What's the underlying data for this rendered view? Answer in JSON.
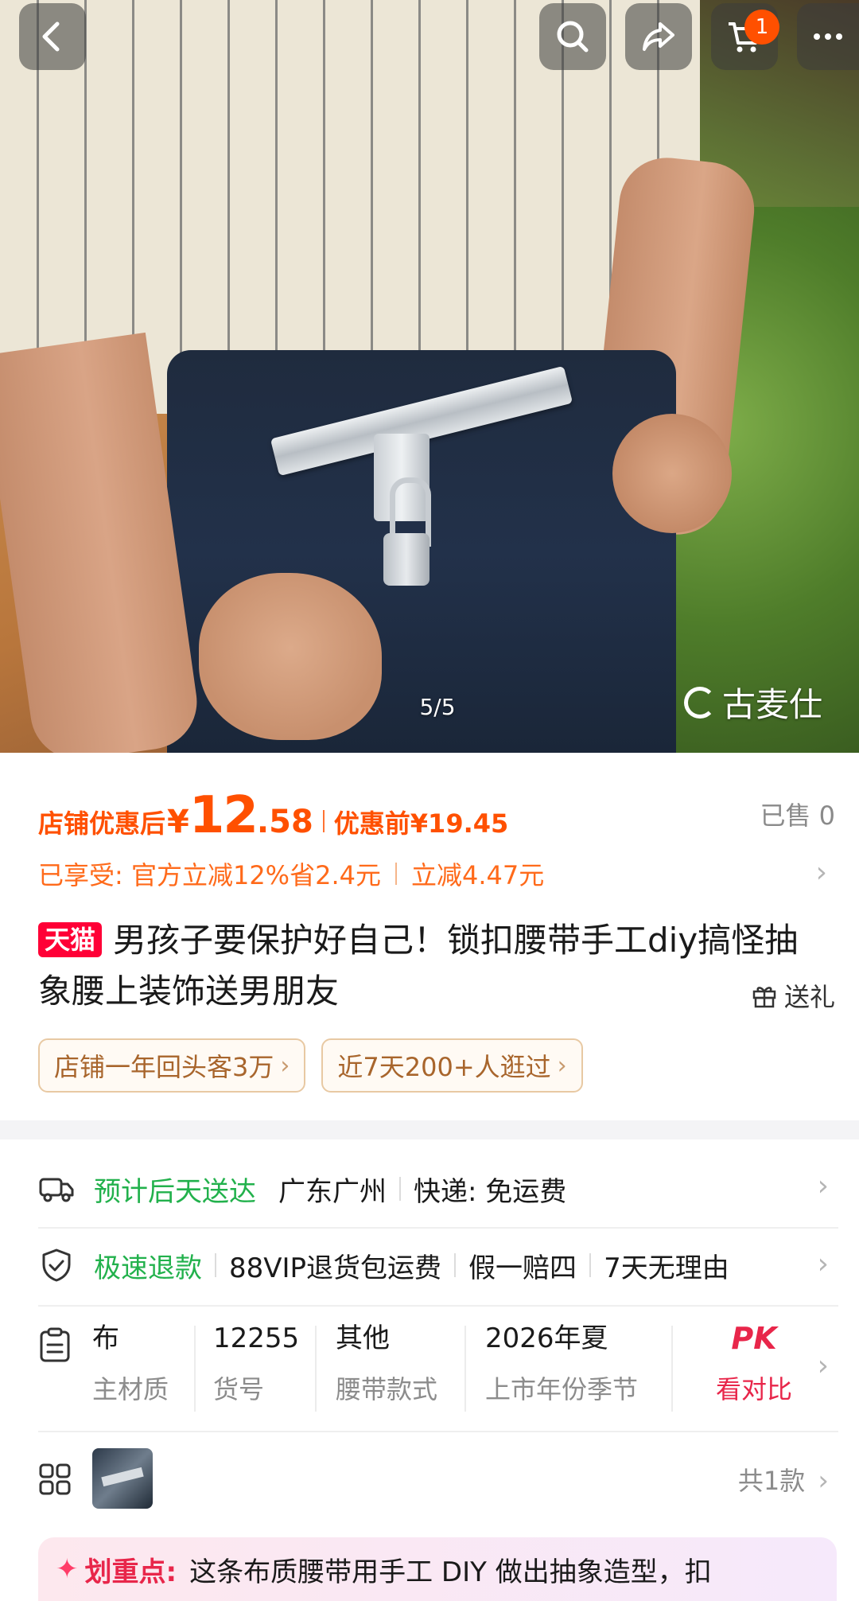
{
  "hero": {
    "pager": "5/5",
    "watermark": "古麦仕"
  },
  "topbar": {
    "cart_badge": "1"
  },
  "price": {
    "after_label": "店铺优惠后",
    "currency": "¥",
    "after_int": "12",
    "after_dec": ".58",
    "before_label": "优惠前¥19.45",
    "sold": "已售 0"
  },
  "promo": {
    "line1": "已享受: 官方立减12%省2.4元",
    "line2": "立减4.47元"
  },
  "title": {
    "badge": "天猫",
    "text": "男孩子要保护好自己！锁扣腰带手工diy搞怪抽象腰上装饰送男朋友",
    "gift": "送礼"
  },
  "chips": [
    "店铺一年回头客3万",
    "近7天200+人逛过"
  ],
  "delivery": {
    "eta": "预计后天送达",
    "origin": "广东广州",
    "shipping": "快递: 免运费"
  },
  "refund": {
    "fast": "极速退款",
    "items": [
      "88VIP退货包运费",
      "假一赔四",
      "7天无理由"
    ]
  },
  "specs": [
    {
      "value": "布",
      "key": "主材质"
    },
    {
      "value": "12255",
      "key": "货号"
    },
    {
      "value": "其他",
      "key": "腰带款式"
    },
    {
      "value": "2026年夏",
      "key": "上市年份季节"
    }
  ],
  "compare": {
    "logo": "PK",
    "label": "看对比"
  },
  "sku": {
    "count": "共1款"
  },
  "highlight": {
    "title": "划重点:",
    "text": "这条布质腰带用手工 DIY 做出抽象造型，扣"
  },
  "colors": {
    "accent": "#ff5000",
    "tmall": "#ff0036",
    "green": "#22b14c",
    "pk": "#e8264a"
  }
}
